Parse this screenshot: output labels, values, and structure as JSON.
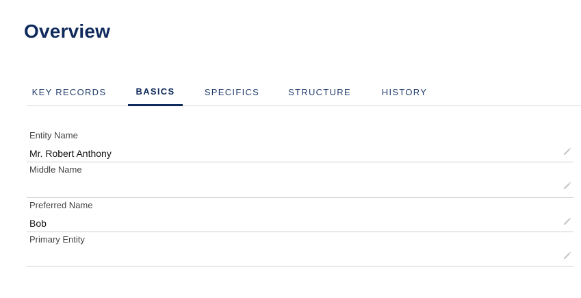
{
  "page": {
    "title": "Overview"
  },
  "tabs": [
    {
      "label": "KEY RECORDS",
      "active": false
    },
    {
      "label": "BASICS",
      "active": true
    },
    {
      "label": "SPECIFICS",
      "active": false
    },
    {
      "label": "STRUCTURE",
      "active": false
    },
    {
      "label": "HISTORY",
      "active": false
    }
  ],
  "fields": [
    {
      "label": "Entity Name",
      "value": "Mr. Robert Anthony",
      "icon": "pencil-icon"
    },
    {
      "label": "Middle Name",
      "value": "",
      "icon": "pencil-icon"
    },
    {
      "label": "Preferred Name",
      "value": "Bob",
      "icon": "pencil-icon"
    },
    {
      "label": "Primary Entity",
      "value": "",
      "icon": "pencil-icon"
    }
  ],
  "colors": {
    "accent": "#0f2a5c",
    "divider": "#cfcfcf",
    "icon": "#bdbdbd"
  }
}
